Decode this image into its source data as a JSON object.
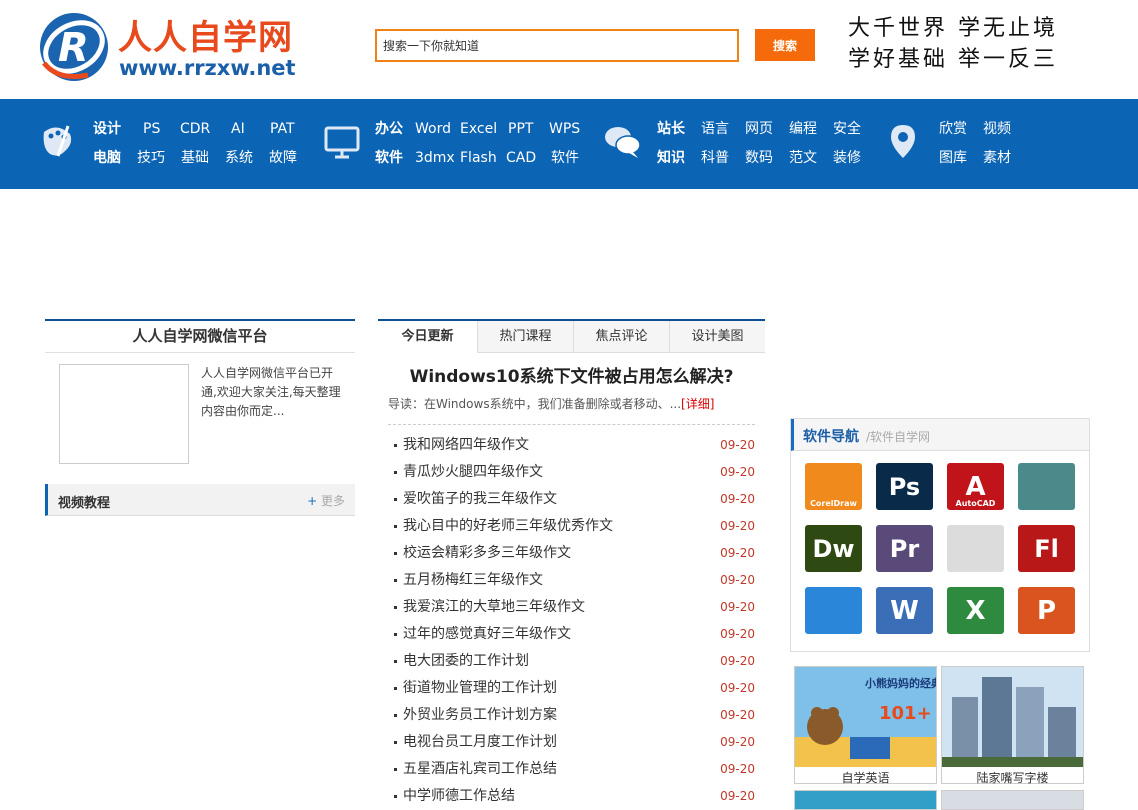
{
  "logo": {
    "title": "人人自学网",
    "url": "www.rrzxw.net"
  },
  "search": {
    "placeholder": "搜索一下你就知道",
    "value": "搜索一下你就知道",
    "button_label": "搜索"
  },
  "slogans": [
    "大千世界  学无止境",
    "学好基础  举一反三"
  ],
  "nav": {
    "groups": [
      {
        "icon": "palette-icon",
        "top": [
          "设计",
          "PS",
          "CDR",
          "AI",
          "PAT"
        ],
        "bottom": [
          "电脑",
          "技巧",
          "基础",
          "系统",
          "故障"
        ]
      },
      {
        "icon": "monitor-icon",
        "top": [
          "办公",
          "Word",
          "Excel",
          "PPT",
          "WPS"
        ],
        "bottom": [
          "软件",
          "3dmx",
          "Flash",
          "CAD",
          "软件"
        ]
      },
      {
        "icon": "chat-icon",
        "top": [
          "站长",
          "语言",
          "网页",
          "编程",
          "安全"
        ],
        "bottom": [
          "知识",
          "科普",
          "数码",
          "范文",
          "装修"
        ]
      },
      {
        "icon": "location-pin-icon",
        "top": [
          "欣赏",
          "视频"
        ],
        "bottom": [
          "图库",
          "素材"
        ]
      }
    ]
  },
  "wechat": {
    "title": "人人自学网微信平台",
    "description": "人人自学网微信平台已开通,欢迎大家关注,每天整理内容由你而定..."
  },
  "video": {
    "title": "视频教程",
    "more_plus": "+",
    "more": "更多"
  },
  "tabs": [
    "今日更新",
    "热门课程",
    "焦点评论",
    "设计美图"
  ],
  "headline": {
    "title": "Windows10系统下文件被占用怎么解决?",
    "lead": "导读：在Windows系统中，我们准备删除或者移动、...",
    "more": "[详细]"
  },
  "articles": [
    {
      "title": "我和网络四年级作文",
      "date": "09-20"
    },
    {
      "title": "青瓜炒火腿四年级作文",
      "date": "09-20"
    },
    {
      "title": "爱吹笛子的我三年级作文",
      "date": "09-20"
    },
    {
      "title": "我心目中的好老师三年级优秀作文",
      "date": "09-20"
    },
    {
      "title": "校运会精彩多多三年级作文",
      "date": "09-20"
    },
    {
      "title": "五月杨梅红三年级作文",
      "date": "09-20"
    },
    {
      "title": "我爱滨江的大草地三年级作文",
      "date": "09-20"
    },
    {
      "title": "过年的感觉真好三年级作文",
      "date": "09-20"
    },
    {
      "title": "电大团委的工作计划",
      "date": "09-20"
    },
    {
      "title": "街道物业管理的工作计划",
      "date": "09-20"
    },
    {
      "title": "外贸业务员工作计划方案",
      "date": "09-20"
    },
    {
      "title": "电视台员工月度工作计划",
      "date": "09-20"
    },
    {
      "title": "五星酒店礼宾司工作总结",
      "date": "09-20"
    },
    {
      "title": "中学师德工作总结",
      "date": "09-20"
    }
  ],
  "software": {
    "title": "软件导航",
    "subtitle": "/软件自学网",
    "icons": [
      {
        "name": "coreldraw-icon",
        "text": "",
        "label": "CorelDraw",
        "color": "#f08a1c"
      },
      {
        "name": "photoshop-icon",
        "text": "Ps",
        "label": "",
        "color": "#0a2a4a"
      },
      {
        "name": "autocad-icon",
        "text": "A",
        "label": "AutoCAD",
        "color": "#c0141a"
      },
      {
        "name": "3dsmax-icon",
        "text": "",
        "label": "",
        "color": "#4a8a8a"
      },
      {
        "name": "dreamweaver-icon",
        "text": "Dw",
        "label": "",
        "color": "#2e4a12"
      },
      {
        "name": "premiere-icon",
        "text": "Pr",
        "label": "",
        "color": "#5a4a7a"
      },
      {
        "name": "video-camera-icon",
        "text": "",
        "label": "",
        "color": "#dcdcdc"
      },
      {
        "name": "flash-icon",
        "text": "Fl",
        "label": "",
        "color": "#b81818"
      },
      {
        "name": "windows-icon",
        "text": "",
        "label": "",
        "color": "#2a86d8"
      },
      {
        "name": "word-icon",
        "text": "W",
        "label": "",
        "color": "#3a6fb8"
      },
      {
        "name": "excel-icon",
        "text": "X",
        "label": "",
        "color": "#2e8a3e"
      },
      {
        "name": "powerpoint-icon",
        "text": "P",
        "label": "",
        "color": "#d9541e"
      }
    ]
  },
  "thumbs": [
    {
      "caption": "自学英语",
      "heading": "小熊妈妈的经典英语绘本",
      "number": "101+"
    },
    {
      "caption": "陆家嘴写字楼"
    }
  ],
  "colors": {
    "brand_blue": "#0b64b4",
    "accent_orange": "#f56b0b",
    "date_red": "#c0392b"
  }
}
